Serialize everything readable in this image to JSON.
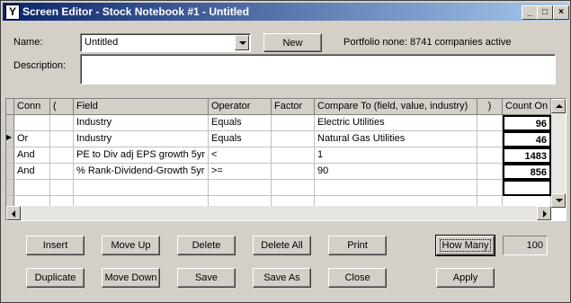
{
  "window": {
    "title": "Screen Editor - Stock Notebook #1 - Untitled",
    "minimize_glyph": "_",
    "maximize_glyph": "□",
    "close_glyph": "×",
    "app_icon_glyph": "Y"
  },
  "form": {
    "name_label": "Name:",
    "name_value": "Untitled",
    "new_button": "New",
    "portfolio_status": "Portfolio none: 8741 companies active",
    "description_label": "Description:",
    "description_value": ""
  },
  "grid": {
    "columns": [
      "Conn",
      "(",
      "Field",
      "Operator",
      "Factor",
      "Compare To (field, value, industry)",
      ")",
      "Count On"
    ],
    "rows": [
      {
        "conn": "",
        "open": "",
        "field": "Industry",
        "operator": "Equals",
        "factor": "",
        "compare": "Electric Utilities",
        "close": "",
        "count": "96"
      },
      {
        "conn": "Or",
        "open": "",
        "field": "Industry",
        "operator": "Equals",
        "factor": "",
        "compare": "Natural Gas Utilities",
        "close": "",
        "count": "46"
      },
      {
        "conn": "And",
        "open": "",
        "field": "PE to Div adj EPS growth 5yr",
        "operator": "<",
        "factor": "",
        "compare": "1",
        "close": "",
        "count": "1483"
      },
      {
        "conn": "And",
        "open": "",
        "field": "% Rank-Dividend-Growth 5yr",
        "operator": ">=",
        "factor": "",
        "compare": "90",
        "close": "",
        "count": "856"
      },
      {
        "conn": "",
        "open": "",
        "field": "",
        "operator": "",
        "factor": "",
        "compare": "",
        "close": "",
        "count": ""
      },
      {
        "conn": "",
        "open": "",
        "field": "",
        "operator": "",
        "factor": "",
        "compare": "",
        "close": "",
        "count": ""
      }
    ],
    "current_row_indicator": "▶"
  },
  "buttons": {
    "insert": "Insert",
    "move_up": "Move Up",
    "delete": "Delete",
    "delete_all": "Delete All",
    "print": "Print",
    "how_many": "How Many",
    "how_many_value": "100",
    "duplicate": "Duplicate",
    "move_down": "Move Down",
    "save": "Save",
    "save_as": "Save As",
    "close": "Close",
    "apply": "Apply"
  },
  "colors": {
    "titlebar_start": "#0a246a",
    "titlebar_end": "#a6caf0",
    "face": "#d4d0c8"
  }
}
